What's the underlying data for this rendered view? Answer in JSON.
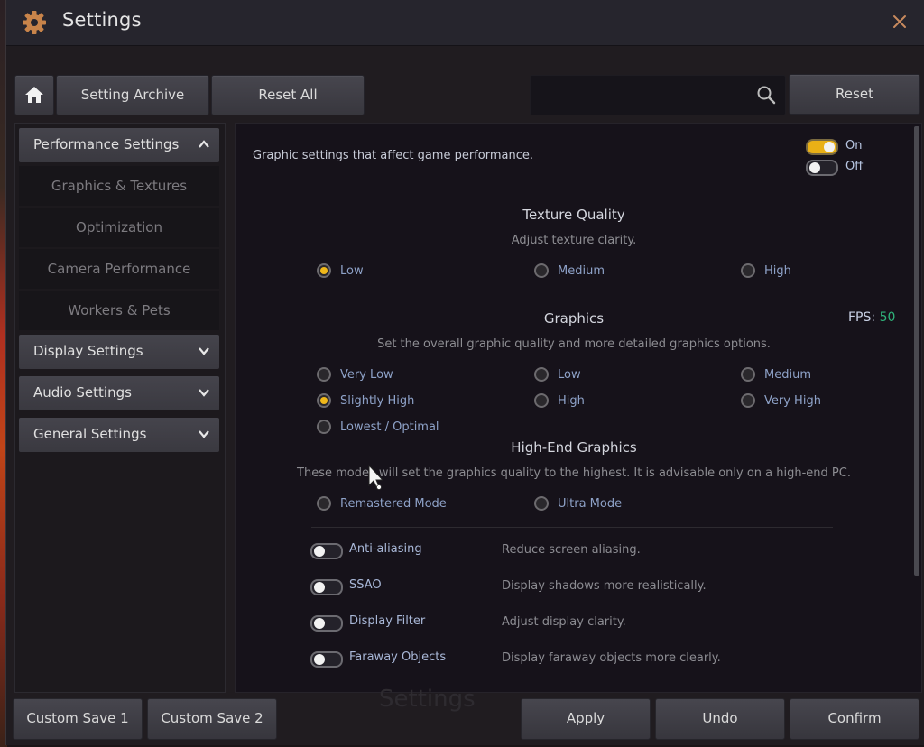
{
  "window": {
    "title": "Settings",
    "icon": "gear-icon",
    "close_icon": "close-icon"
  },
  "toolbar": {
    "home_icon": "home-icon",
    "setting_archive": "Setting Archive",
    "reset_all": "Reset All",
    "search_placeholder": "",
    "search_value": "",
    "search_icon": "search-icon",
    "reset": "Reset"
  },
  "sidebar": {
    "categories": [
      {
        "label": "Performance Settings",
        "expanded": true,
        "chevron": "chevron-up-icon"
      },
      {
        "label": "Display Settings",
        "expanded": false,
        "chevron": "chevron-down-icon"
      },
      {
        "label": "Audio Settings",
        "expanded": false,
        "chevron": "chevron-down-icon"
      },
      {
        "label": "General Settings",
        "expanded": false,
        "chevron": "chevron-down-icon"
      }
    ],
    "subitems": [
      {
        "label": "Graphics & Textures"
      },
      {
        "label": "Optimization"
      },
      {
        "label": "Camera Performance"
      },
      {
        "label": "Workers & Pets"
      }
    ]
  },
  "content": {
    "intro": "Graphic settings that affect game performance.",
    "legend": {
      "on_label": "On",
      "off_label": "Off"
    },
    "texture_quality": {
      "title": "Texture Quality",
      "subtitle": "Adjust texture clarity.",
      "options": [
        "Low",
        "Medium",
        "High"
      ],
      "selected": "Low"
    },
    "graphics": {
      "title": "Graphics",
      "fps_label": "FPS:",
      "fps_value": "50",
      "fps_color": "#2fb37a",
      "subtitle": "Set the overall graphic quality and more detailed graphics options.",
      "options": [
        "Very Low",
        "Low",
        "Medium",
        "Slightly High",
        "High",
        "Very High",
        "Lowest / Optimal"
      ],
      "selected": "Slightly High"
    },
    "high_end": {
      "title": "High-End Graphics",
      "subtitle": "These modes will set the graphics quality to the highest. It is advisable only on a high-end PC.",
      "options": [
        "Remastered Mode",
        "Ultra Mode"
      ],
      "selected": null
    },
    "toggles": [
      {
        "label": "Anti-aliasing",
        "description": "Reduce screen aliasing.",
        "on": false
      },
      {
        "label": "SSAO",
        "description": "Display shadows more realistically.",
        "on": false
      },
      {
        "label": "Display Filter",
        "description": "Adjust display clarity.",
        "on": false
      },
      {
        "label": "Faraway Objects",
        "description": "Display faraway objects more clearly.",
        "on": false
      }
    ]
  },
  "footer": {
    "custom_save_1": "Custom Save 1",
    "custom_save_2": "Custom Save 2",
    "ghost_title": "Settings",
    "apply": "Apply",
    "undo": "Undo",
    "confirm": "Confirm"
  },
  "colors": {
    "accent": "#f0b81a",
    "close": "#c88a5e",
    "option_text": "#8ea2c8"
  }
}
